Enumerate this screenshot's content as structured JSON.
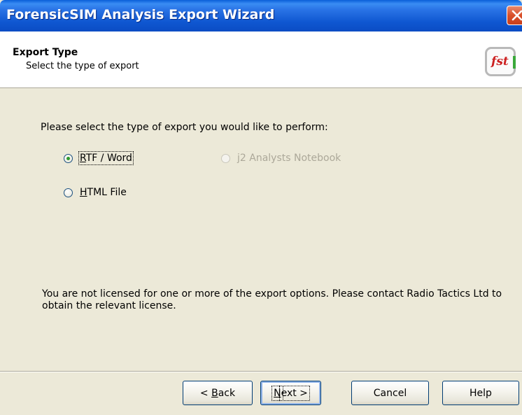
{
  "window": {
    "title": "ForensicSIM Analysis Export Wizard"
  },
  "header": {
    "title": "Export Type",
    "subtitle": "Select the type of export",
    "logo_text": "fst"
  },
  "content": {
    "prompt": "Please select the type of export you would like to perform:",
    "options": [
      {
        "mnemonic": "R",
        "rest": "TF / Word",
        "checked": true,
        "enabled": true
      },
      {
        "mnemonic": "j",
        "rest": "2 Analysts Notebook",
        "checked": false,
        "enabled": false
      },
      {
        "mnemonic": "H",
        "rest": "TML File",
        "checked": false,
        "enabled": true
      }
    ],
    "license_message": "You are not licensed for one or more of the export options. Please contact Radio Tactics Ltd to obtain the relevant license."
  },
  "buttons": {
    "back": {
      "prefix": "< ",
      "mnemonic": "B",
      "rest": "ack"
    },
    "next": {
      "mnemonic": "N",
      "rest": "ext >"
    },
    "cancel": "Cancel",
    "help": "Help"
  },
  "colors": {
    "titlebar": "#0b4cc4",
    "face": "#ece9d8",
    "radio_dot": "#2e9a2e",
    "logo_red": "#cc2020",
    "logo_green": "#3aa83a"
  },
  "icons": {
    "close": "close-icon",
    "logo": "fst-logo"
  }
}
